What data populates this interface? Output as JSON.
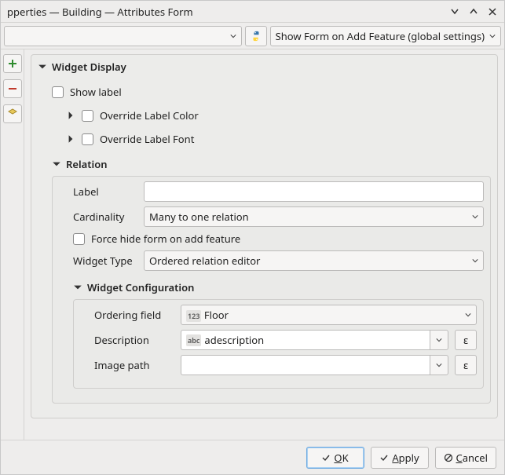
{
  "window": {
    "title": "pperties — Building — Attributes Form"
  },
  "toolbar": {
    "show_form_label": "Show Form on Add Feature (global settings)"
  },
  "widget_display": {
    "title": "Widget Display",
    "show_label": "Show label",
    "override_color": "Override Label Color",
    "override_font": "Override Label Font"
  },
  "relation": {
    "title": "Relation",
    "label_label": "Label",
    "label_value": "",
    "cardinality_label": "Cardinality",
    "cardinality_value": "Many to one relation",
    "force_hide_label": "Force hide form on add feature",
    "widget_type_label": "Widget Type",
    "widget_type_value": "Ordered relation editor"
  },
  "widget_config": {
    "title": "Widget Configuration",
    "ordering_label": "Ordering field",
    "ordering_type": "123",
    "ordering_value": "Floor",
    "description_label": "Description",
    "description_type": "abc",
    "description_value": "adescription",
    "image_path_label": "Image path",
    "image_path_value": ""
  },
  "buttons": {
    "ok_pre": "",
    "ok_mn": "O",
    "ok_post": "K",
    "apply_pre": "",
    "apply_mn": "A",
    "apply_post": "pply",
    "cancel_pre": "",
    "cancel_mn": "C",
    "cancel_post": "ancel"
  }
}
